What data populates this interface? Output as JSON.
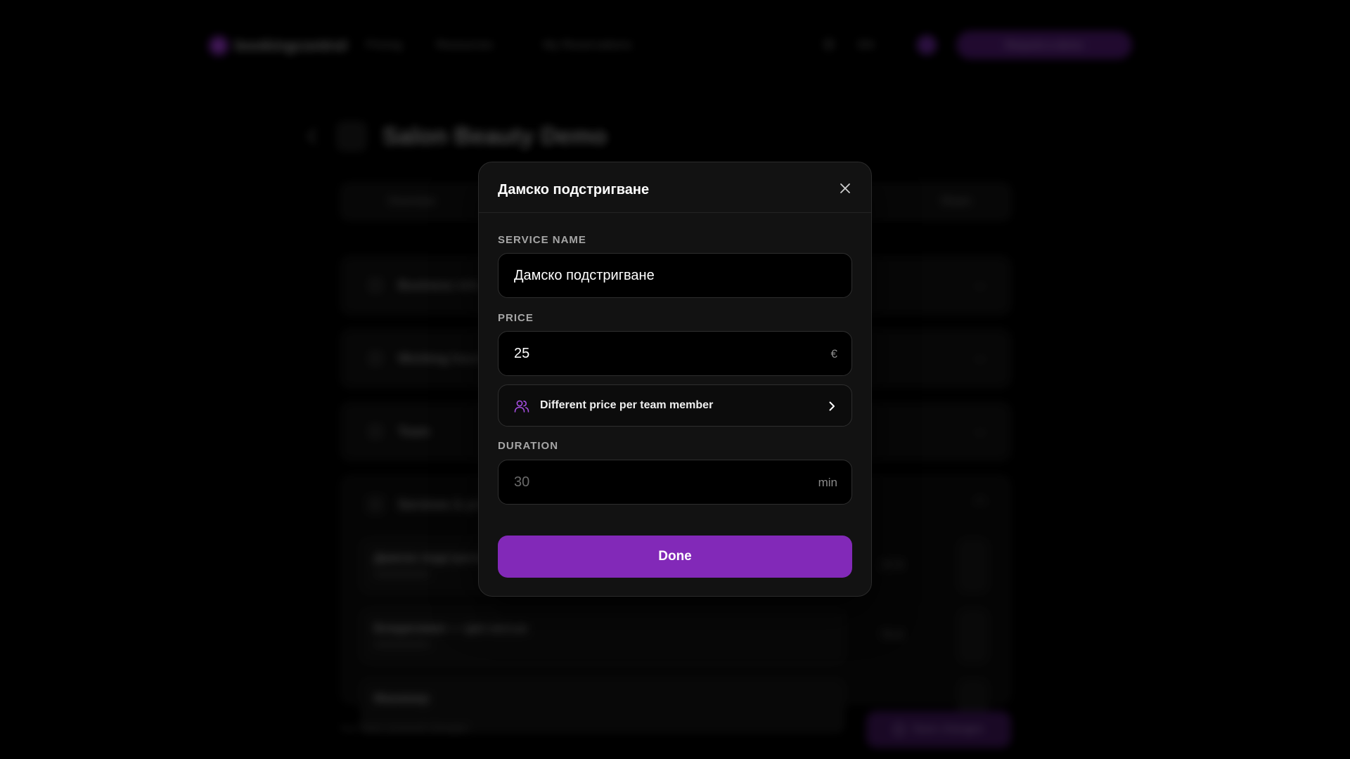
{
  "background": {
    "nav": {
      "logo": "bookingcontrol",
      "links": [
        "Pricing",
        "Resources",
        "My Reservations"
      ],
      "language": "EN",
      "cta": "Request a demo"
    },
    "page_title": "Salon Beauty Demo",
    "tabs": [
      "Overview",
      "Share"
    ],
    "sections": [
      "Business info",
      "Working hours",
      "Team",
      "Services & prices"
    ],
    "services": [
      {
        "name": "Дамско подстригване",
        "meta": "25 €"
      },
      {
        "name": "Боядисване — цял косъм",
        "meta": "75 €"
      },
      {
        "name": "Маникюр",
        "meta": ""
      }
    ],
    "footer_note": "You have unsaved changes",
    "save_label": "Save changes"
  },
  "modal": {
    "title": "Дамско подстригване",
    "service_name": {
      "label": "SERVICE NAME",
      "value": "Дамско подстригване"
    },
    "price": {
      "label": "PRICE",
      "value": "25",
      "currency": "€"
    },
    "team_price": {
      "label": "Different price per team member",
      "icon": "users-icon"
    },
    "duration": {
      "label": "DURATION",
      "placeholder": "30",
      "unit": "min"
    },
    "done_label": "Done"
  },
  "colors": {
    "accent": "#8229b8",
    "background": "#000000",
    "modal_bg": "#121212"
  }
}
